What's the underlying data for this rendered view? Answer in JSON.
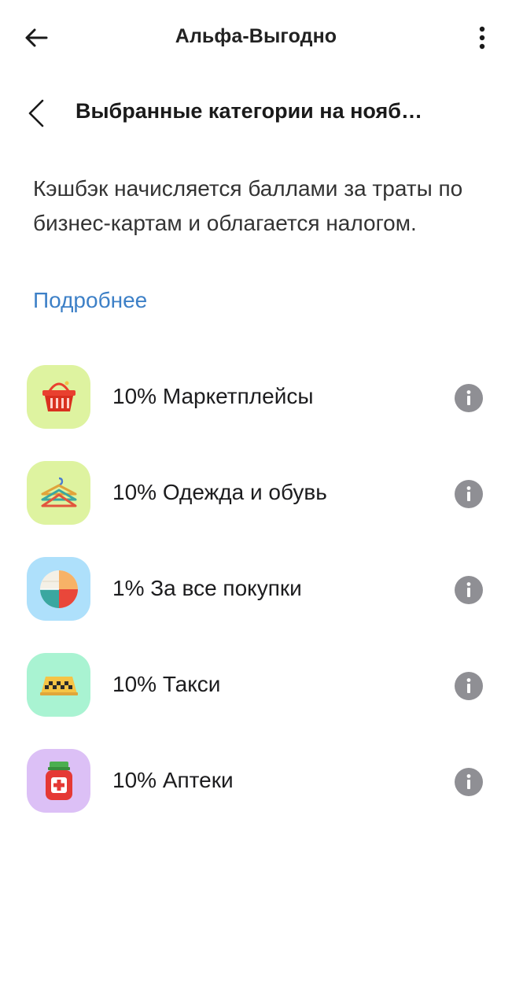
{
  "appbar": {
    "title": "Альфа-Выгодно",
    "back_icon": "arrow-left-icon",
    "menu_icon": "more-vertical-icon"
  },
  "subheader": {
    "title": "Выбранные категории на нояб…",
    "back_icon": "chevron-left-icon"
  },
  "description": "Кэшбэк начисляется баллами за траты по бизнес-картам и облагается налогом.",
  "more_link": "Подробнее",
  "colors": {
    "link": "#3d80c7",
    "info_icon": "#8f8f94",
    "tile_marketplaces": "#def3a0",
    "tile_clothes": "#def3a0",
    "tile_all": "#aee0fb",
    "tile_taxi": "#a9f3d2",
    "tile_pharmacy": "#dcc0f6"
  },
  "categories": [
    {
      "label": "10% Маркетплейсы",
      "icon": "shopping-basket-icon"
    },
    {
      "label": "10% Одежда и обувь",
      "icon": "hangers-icon"
    },
    {
      "label": "1% За все покупки",
      "icon": "pie-chart-icon"
    },
    {
      "label": "10% Такси",
      "icon": "taxi-sign-icon"
    },
    {
      "label": "10% Аптеки",
      "icon": "medicine-jar-icon"
    }
  ]
}
